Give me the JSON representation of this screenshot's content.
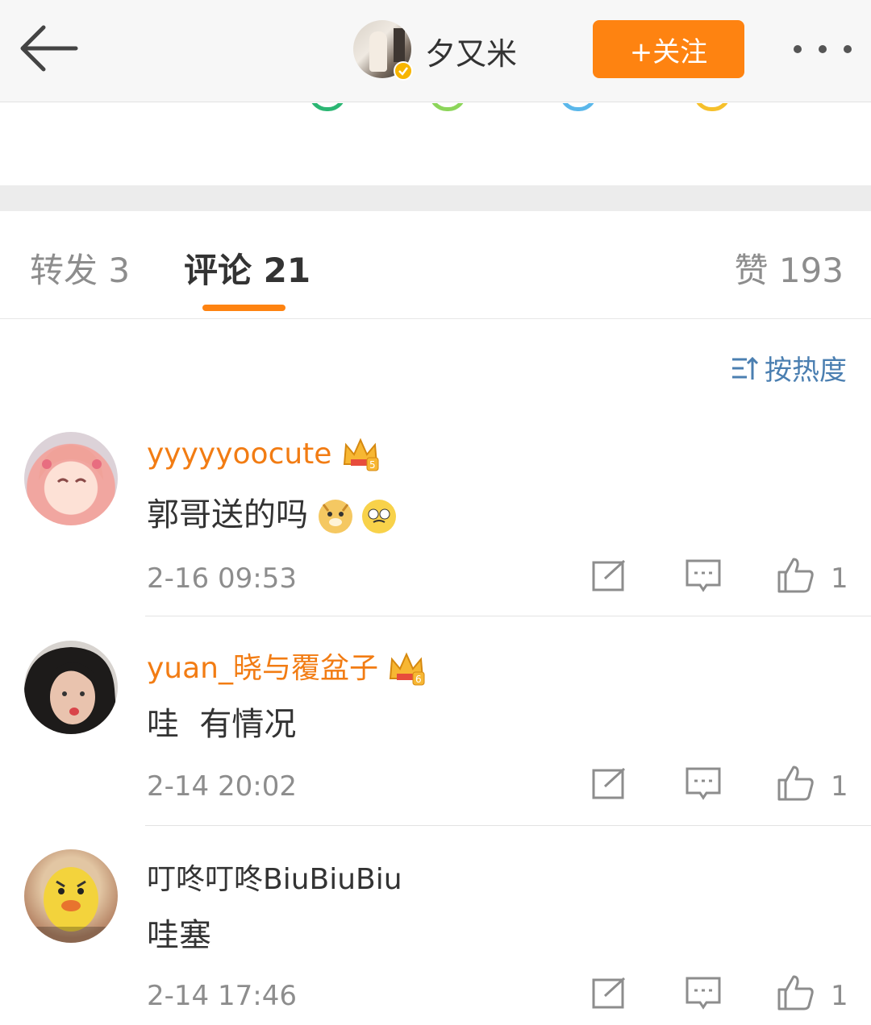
{
  "header": {
    "back_icon": "arrow-left-icon",
    "user_name": "夕又米",
    "verified_icon": "verified-badge-icon",
    "follow_label": "+关注",
    "more_icon": "more-dots-icon"
  },
  "tabs": {
    "repost": "转发 3",
    "comment": "评论 21",
    "likes": "赞 193",
    "active": "comment"
  },
  "sort": {
    "label": "按热度",
    "icon": "sort-icon"
  },
  "comments": [
    {
      "username": "yyyyyoocute",
      "badge": "crown-member-icon",
      "badge_level": "5",
      "text": "郭哥送的吗",
      "emojis": [
        "doge-emoji",
        "tearful-emoji"
      ],
      "time": "2-16 09:53",
      "likes": "1"
    },
    {
      "username": "yuan_晓与覆盆子",
      "badge": "crown-member-icon",
      "badge_level": "6",
      "text": "哇  有情况",
      "emojis": [],
      "time": "2-14 20:02",
      "likes": "1"
    },
    {
      "username": "叮咚叮咚BiuBiuBiu",
      "badge": "",
      "text": "哇塞",
      "emojis": [],
      "time": "2-14 17:46",
      "likes": "1"
    }
  ],
  "colors": {
    "accent": "#fe8311",
    "member_name": "#f27c13",
    "link_blue": "#4b7fb1",
    "muted": "#8d8d8d"
  }
}
